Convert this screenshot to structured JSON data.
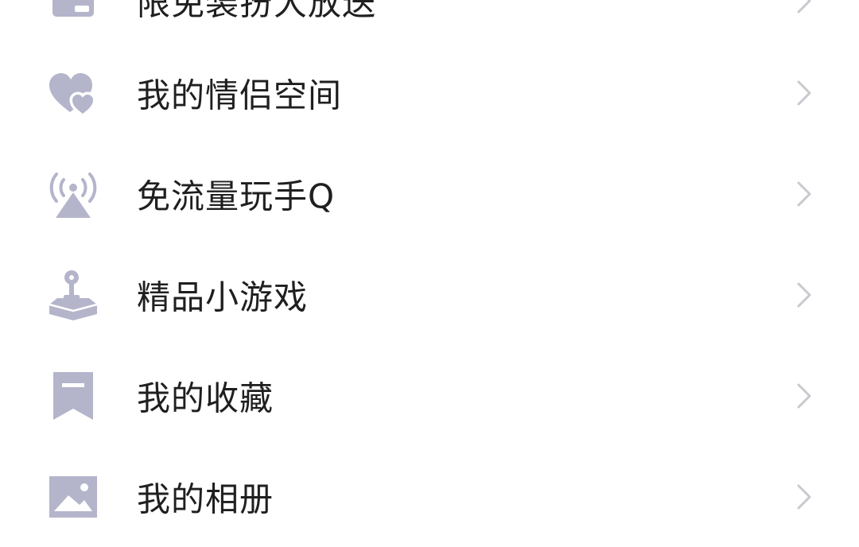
{
  "colors": {
    "icon": "#b4b4cb",
    "text": "#1f1f1f",
    "chevron": "#c9c9cf",
    "background": "#ffffff"
  },
  "menu": {
    "items": [
      {
        "label": "限免装扮大放送",
        "icon": "card-icon"
      },
      {
        "label": "我的情侣空间",
        "icon": "hearts-icon"
      },
      {
        "label": "免流量玩手Q",
        "icon": "signal-tower-icon"
      },
      {
        "label": "精品小游戏",
        "icon": "joystick-icon"
      },
      {
        "label": "我的收藏",
        "icon": "bookmark-icon"
      },
      {
        "label": "我的相册",
        "icon": "photo-icon"
      }
    ]
  }
}
